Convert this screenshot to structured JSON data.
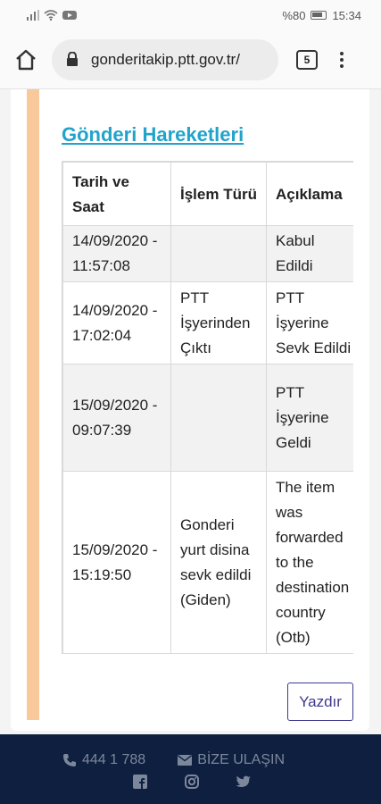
{
  "status_bar": {
    "battery_text": "%80",
    "time": "15:34"
  },
  "browser": {
    "url": "gonderitakip.ptt.gov.tr/",
    "tab_count": "5"
  },
  "section": {
    "title": "Gönderi Hareketleri"
  },
  "table": {
    "headers": [
      "Tarih ve Saat",
      "İşlem Türü",
      "Açıklama"
    ],
    "rows": [
      {
        "date": "14/09/2020 - 11:57:08",
        "type": "",
        "desc": [
          "Kabul",
          "Edildi"
        ]
      },
      {
        "date": "14/09/2020 - 17:02:04",
        "type": "PTT İşyerinden Çıktı",
        "desc": [
          "PTT",
          "İşyerine",
          "Sevk Edildi"
        ]
      },
      {
        "date": "15/09/2020 - 09:07:39",
        "type": "",
        "desc": [
          "PTT",
          "İşyerine",
          "Geldi"
        ]
      },
      {
        "date": "15/09/2020 - 15:19:50",
        "type": "Gonderi yurt disina sevk edildi (Giden)",
        "desc": [
          "The item",
          "was",
          "forwarded",
          "to the",
          "destination",
          "country",
          "(Otb)"
        ]
      }
    ]
  },
  "actions": {
    "print_label": "Yazdır"
  },
  "footer": {
    "phone": "444 1 788",
    "contact": "BİZE ULAŞIN"
  },
  "colors": {
    "title": "#22a3c9",
    "accent": "#f8c99b",
    "footer_bg": "#0e1f3f",
    "button": "#3d3a8c"
  }
}
